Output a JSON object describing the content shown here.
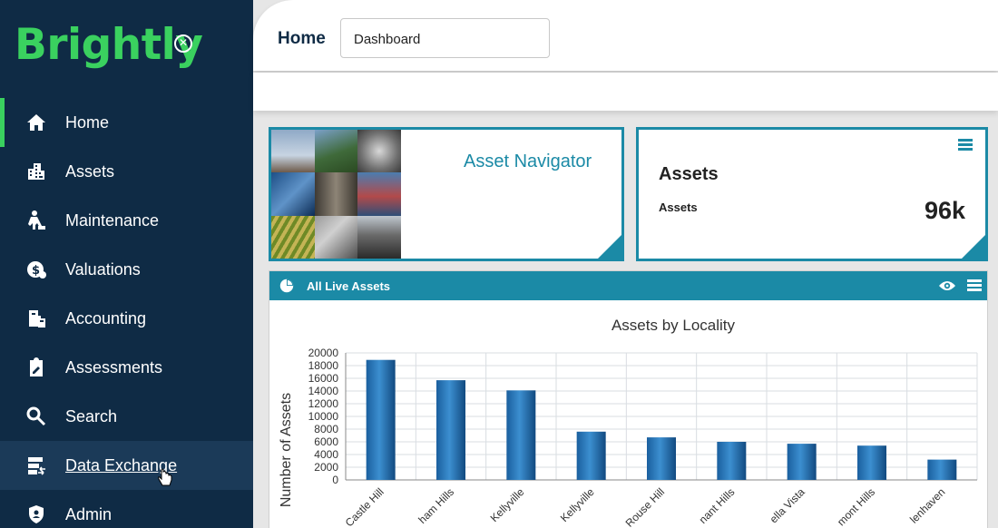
{
  "brand": {
    "name": "Brightly"
  },
  "sidebar": {
    "items": [
      {
        "label": "Home",
        "icon": "home-icon"
      },
      {
        "label": "Assets",
        "icon": "buildings-icon"
      },
      {
        "label": "Maintenance",
        "icon": "worker-icon"
      },
      {
        "label": "Valuations",
        "icon": "money-icon"
      },
      {
        "label": "Accounting",
        "icon": "accounting-icon"
      },
      {
        "label": "Assessments",
        "icon": "clipboard-icon"
      },
      {
        "label": "Search",
        "icon": "search-icon"
      },
      {
        "label": "Data Exchange",
        "icon": "data-exchange-icon"
      },
      {
        "label": "Admin",
        "icon": "shield-icon"
      }
    ],
    "active": "Home",
    "hovered": "Data Exchange"
  },
  "header": {
    "title": "Home",
    "dashboard_value": "Dashboard"
  },
  "cards": {
    "navigator": {
      "title": "Asset Navigator"
    },
    "assets": {
      "title": "Assets",
      "subtitle": "Assets",
      "value": "96k"
    }
  },
  "panel": {
    "title": "All Live Assets"
  },
  "colors": {
    "sidebar": "#0f2b45",
    "accent": "#1b8aa6",
    "brand": "#3ad15f"
  },
  "chart_data": {
    "type": "bar",
    "title": "Assets by Locality",
    "ylabel": "Number of Assets",
    "xlabel": "",
    "ylim": [
      0,
      20000
    ],
    "yticks": [
      0,
      2000,
      4000,
      6000,
      8000,
      10000,
      12000,
      14000,
      16000,
      18000,
      20000
    ],
    "categories": [
      "Castle Hill",
      "Baulkham Hills",
      "Kellyville",
      "North Kellyville",
      "Rouse Hill",
      "Pennant Hills",
      "Bella Vista",
      "Beaumont Hills",
      "Glenhaven"
    ],
    "tick_labels_visible": [
      "Castle Hill",
      "ham Hills",
      "Kellyville",
      "Kellyville",
      "Rouse Hill",
      "nant Hills",
      "ella Vista",
      "mont Hills",
      "lenhaven"
    ],
    "values": [
      18900,
      15700,
      14100,
      7600,
      6700,
      6000,
      5700,
      5400,
      3200
    ]
  }
}
